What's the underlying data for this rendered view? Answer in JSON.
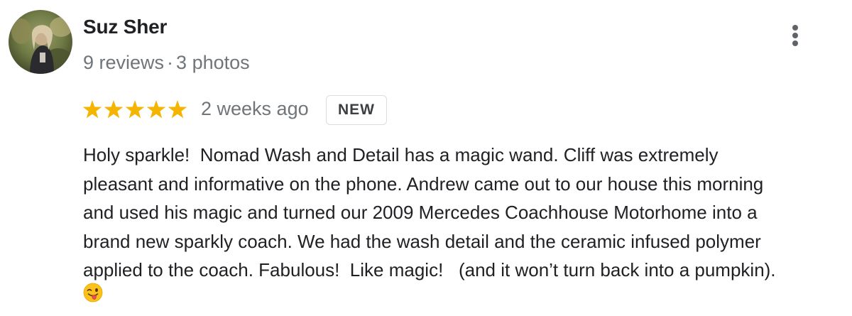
{
  "reviewer": {
    "name": "Suz Sher",
    "reviews": "9 reviews",
    "separator": "·",
    "photos": "3 photos"
  },
  "review": {
    "rating": 5,
    "rating_max": 5,
    "date": "2 weeks ago",
    "badge": "NEW",
    "text_lines": [
      "Holy sparkle!  Nomad Wash and Detail has a magic wand. Cliff was extremely",
      "pleasant and informative on the phone. Andrew came out to our house this morning",
      "and used his magic and turned our 2009 Mercedes Coachhouse Motorhome into a",
      "brand new sparkly coach. We had the wash detail and the ceramic infused polymer",
      "applied to the coach. Fabulous!  Like magic!   (and it won’t turn back into a pumpkin)."
    ],
    "emoji": "winking-face-with-tongue"
  },
  "colors": {
    "star": "#f4b400",
    "muted_text": "#70757a",
    "text": "#202124",
    "badge_border": "#dadce0"
  }
}
